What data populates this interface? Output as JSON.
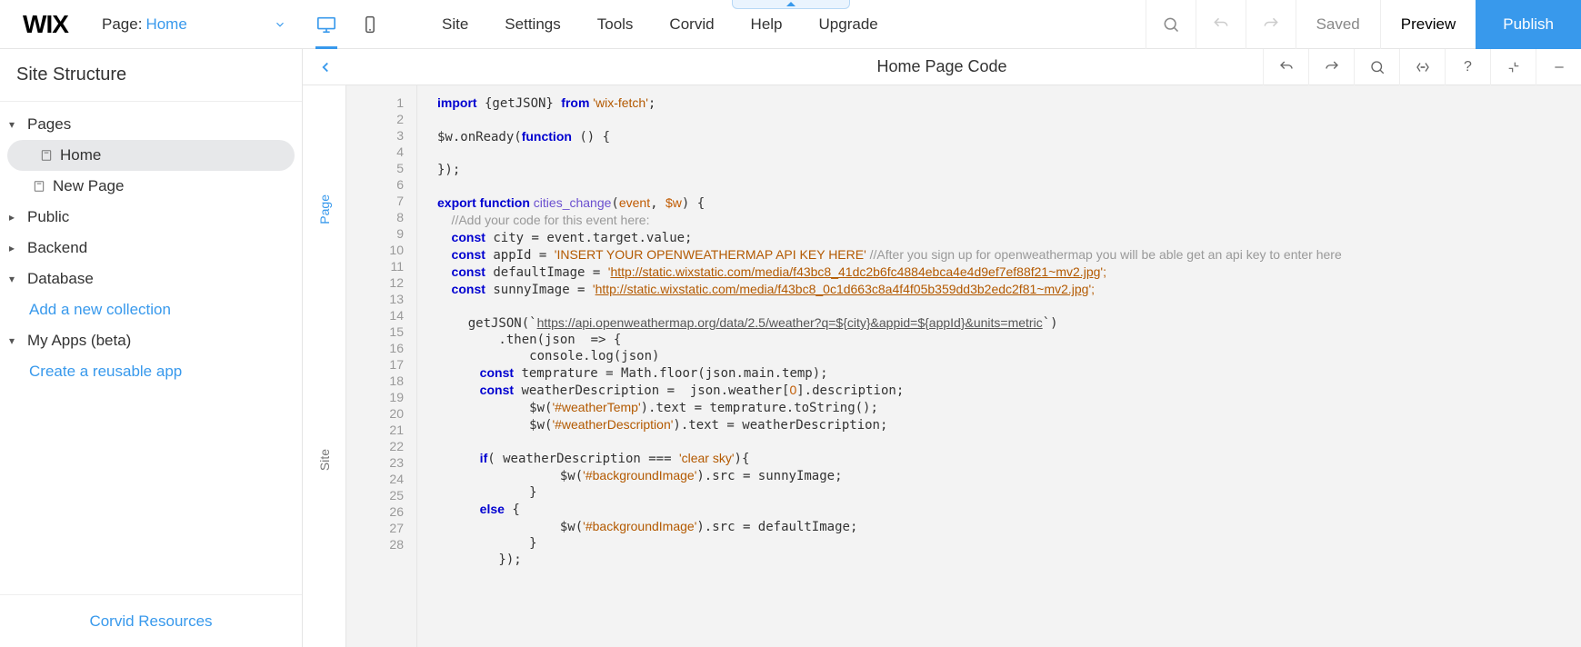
{
  "logo": "WIX",
  "pageSelector": {
    "label": "Page:",
    "value": "Home"
  },
  "menus": [
    "Site",
    "Settings",
    "Tools",
    "Corvid",
    "Help",
    "Upgrade"
  ],
  "topStatus": {
    "saved": "Saved",
    "preview": "Preview",
    "publish": "Publish"
  },
  "sidebar": {
    "title": "Site Structure",
    "sections": [
      {
        "label": "Pages",
        "expanded": true,
        "children": [
          {
            "label": "Home",
            "selected": true
          },
          {
            "label": "New Page",
            "selected": false
          }
        ]
      },
      {
        "label": "Public",
        "expanded": false
      },
      {
        "label": "Backend",
        "expanded": false
      },
      {
        "label": "Database",
        "expanded": true,
        "link": "Add a new collection"
      },
      {
        "label": "My Apps (beta)",
        "expanded": true,
        "link": "Create a reusable app"
      }
    ],
    "footer": "Corvid Resources"
  },
  "codeHeader": "Home Page Code",
  "verticalTabs": {
    "page": "Page",
    "site": "Site"
  },
  "lineCount": 28,
  "code": {
    "l1_import": "import",
    "l1_getjson": " {getJSON} ",
    "l1_from": "from",
    "l1_mod": " 'wix-fetch'",
    "l1_semi": ";",
    "l3_pre": "$w.onReady(",
    "l3_fn": "function",
    "l3_post": " () {",
    "l5": "});",
    "l7_export": "export",
    "l7_function": " function ",
    "l7_name": "cities_change",
    "l7_open": "(",
    "l7_p1": "event",
    "l7_comma": ", ",
    "l7_p2": "$w",
    "l7_close": ") {",
    "l8_cm": "    //Add your code for this event here:",
    "l9_const": "    const",
    "l9_rest": " city = event.target.value;",
    "l10_const": "    const",
    "l10_rest": " appId = ",
    "l10_str": "'INSERT YOUR OPENWEATHERMAP API KEY HERE'",
    "l10_cm": " //After you sign up for openweathermap you will be able get an api key to enter here",
    "l11_const": "    const",
    "l11_rest": " defaultImage = ",
    "l11_q": "'",
    "l11_url": "http://static.wixstatic.com/media/f43bc8_41dc2b6fc4884ebca4e4d9ef7ef88f21~mv2.jpg",
    "l11_end": "';",
    "l12_const": "    const",
    "l12_rest": " sunnyImage = ",
    "l12_q": "'",
    "l12_url": "http://static.wixstatic.com/media/f43bc8_0c1d663c8a4f4f05b359dd3b2edc2f81~mv2.jpg",
    "l12_end": "';",
    "l14_pre": "    getJSON(`",
    "l14_url": "https://api.openweathermap.org/data/2.5/weather?q=${city}&appid=${appId}&units=metric",
    "l14_post": "`)",
    "l15": "        .then(json  => {",
    "l16": "            console.log(json)",
    "l17_const": "            const",
    "l17_rest": " temprature = Math.floor(json.main.temp);",
    "l18_const": "            const",
    "l18_rest": " weatherDescription =  json.weather[",
    "l18_num": "0",
    "l18_rest2": "].description;",
    "l19_pre": "            $w(",
    "l19_str": "'#weatherTemp'",
    "l19_post": ").text = temprature.toString();",
    "l20_pre": "            $w(",
    "l20_str": "'#weatherDescription'",
    "l20_post": ").text = weatherDescription;",
    "l22_if": "            if",
    "l22_mid": "( weatherDescription === ",
    "l22_str": "'clear sky'",
    "l22_end": "){",
    "l23_pre": "                $w(",
    "l23_str": "'#backgroundImage'",
    "l23_post": ").src = sunnyImage;",
    "l24": "            }",
    "l25_else": "            else",
    "l25_rest": " {",
    "l26_pre": "                $w(",
    "l26_str": "'#backgroundImage'",
    "l26_post": ").src = defaultImage;",
    "l27": "            }",
    "l28": "        });"
  }
}
